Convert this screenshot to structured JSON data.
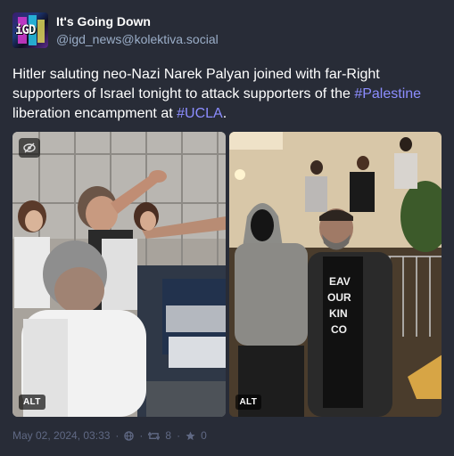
{
  "account": {
    "display_name": "It's Going Down",
    "handle": "@igd_news@kolektiva.social",
    "avatar_text": "iGD"
  },
  "post": {
    "text_part1": "Hitler saluting neo-Nazi Narek Palyan joined with far-Right supporters of Israel tonight to attack supporters of the ",
    "hashtag1": "#Palestine",
    "text_part2": " liberation encampment at ",
    "hashtag2": "#UCLA",
    "text_part3": "."
  },
  "media": [
    {
      "alt_label": "ALT"
    },
    {
      "alt_label": "ALT"
    }
  ],
  "overlay_text": {
    "shirt": "EAV OUR KIN CO"
  },
  "footer": {
    "timestamp": "May 02, 2024, 03:33",
    "dot": "·",
    "boosts": "8",
    "favourites": "0"
  },
  "colors": {
    "background": "#282c37",
    "hashtag": "#8c8dff",
    "muted": "#9baec8",
    "footer": "#606984"
  },
  "icons": [
    "globe-icon",
    "boost-icon",
    "star-icon",
    "eye-slash-icon"
  ]
}
